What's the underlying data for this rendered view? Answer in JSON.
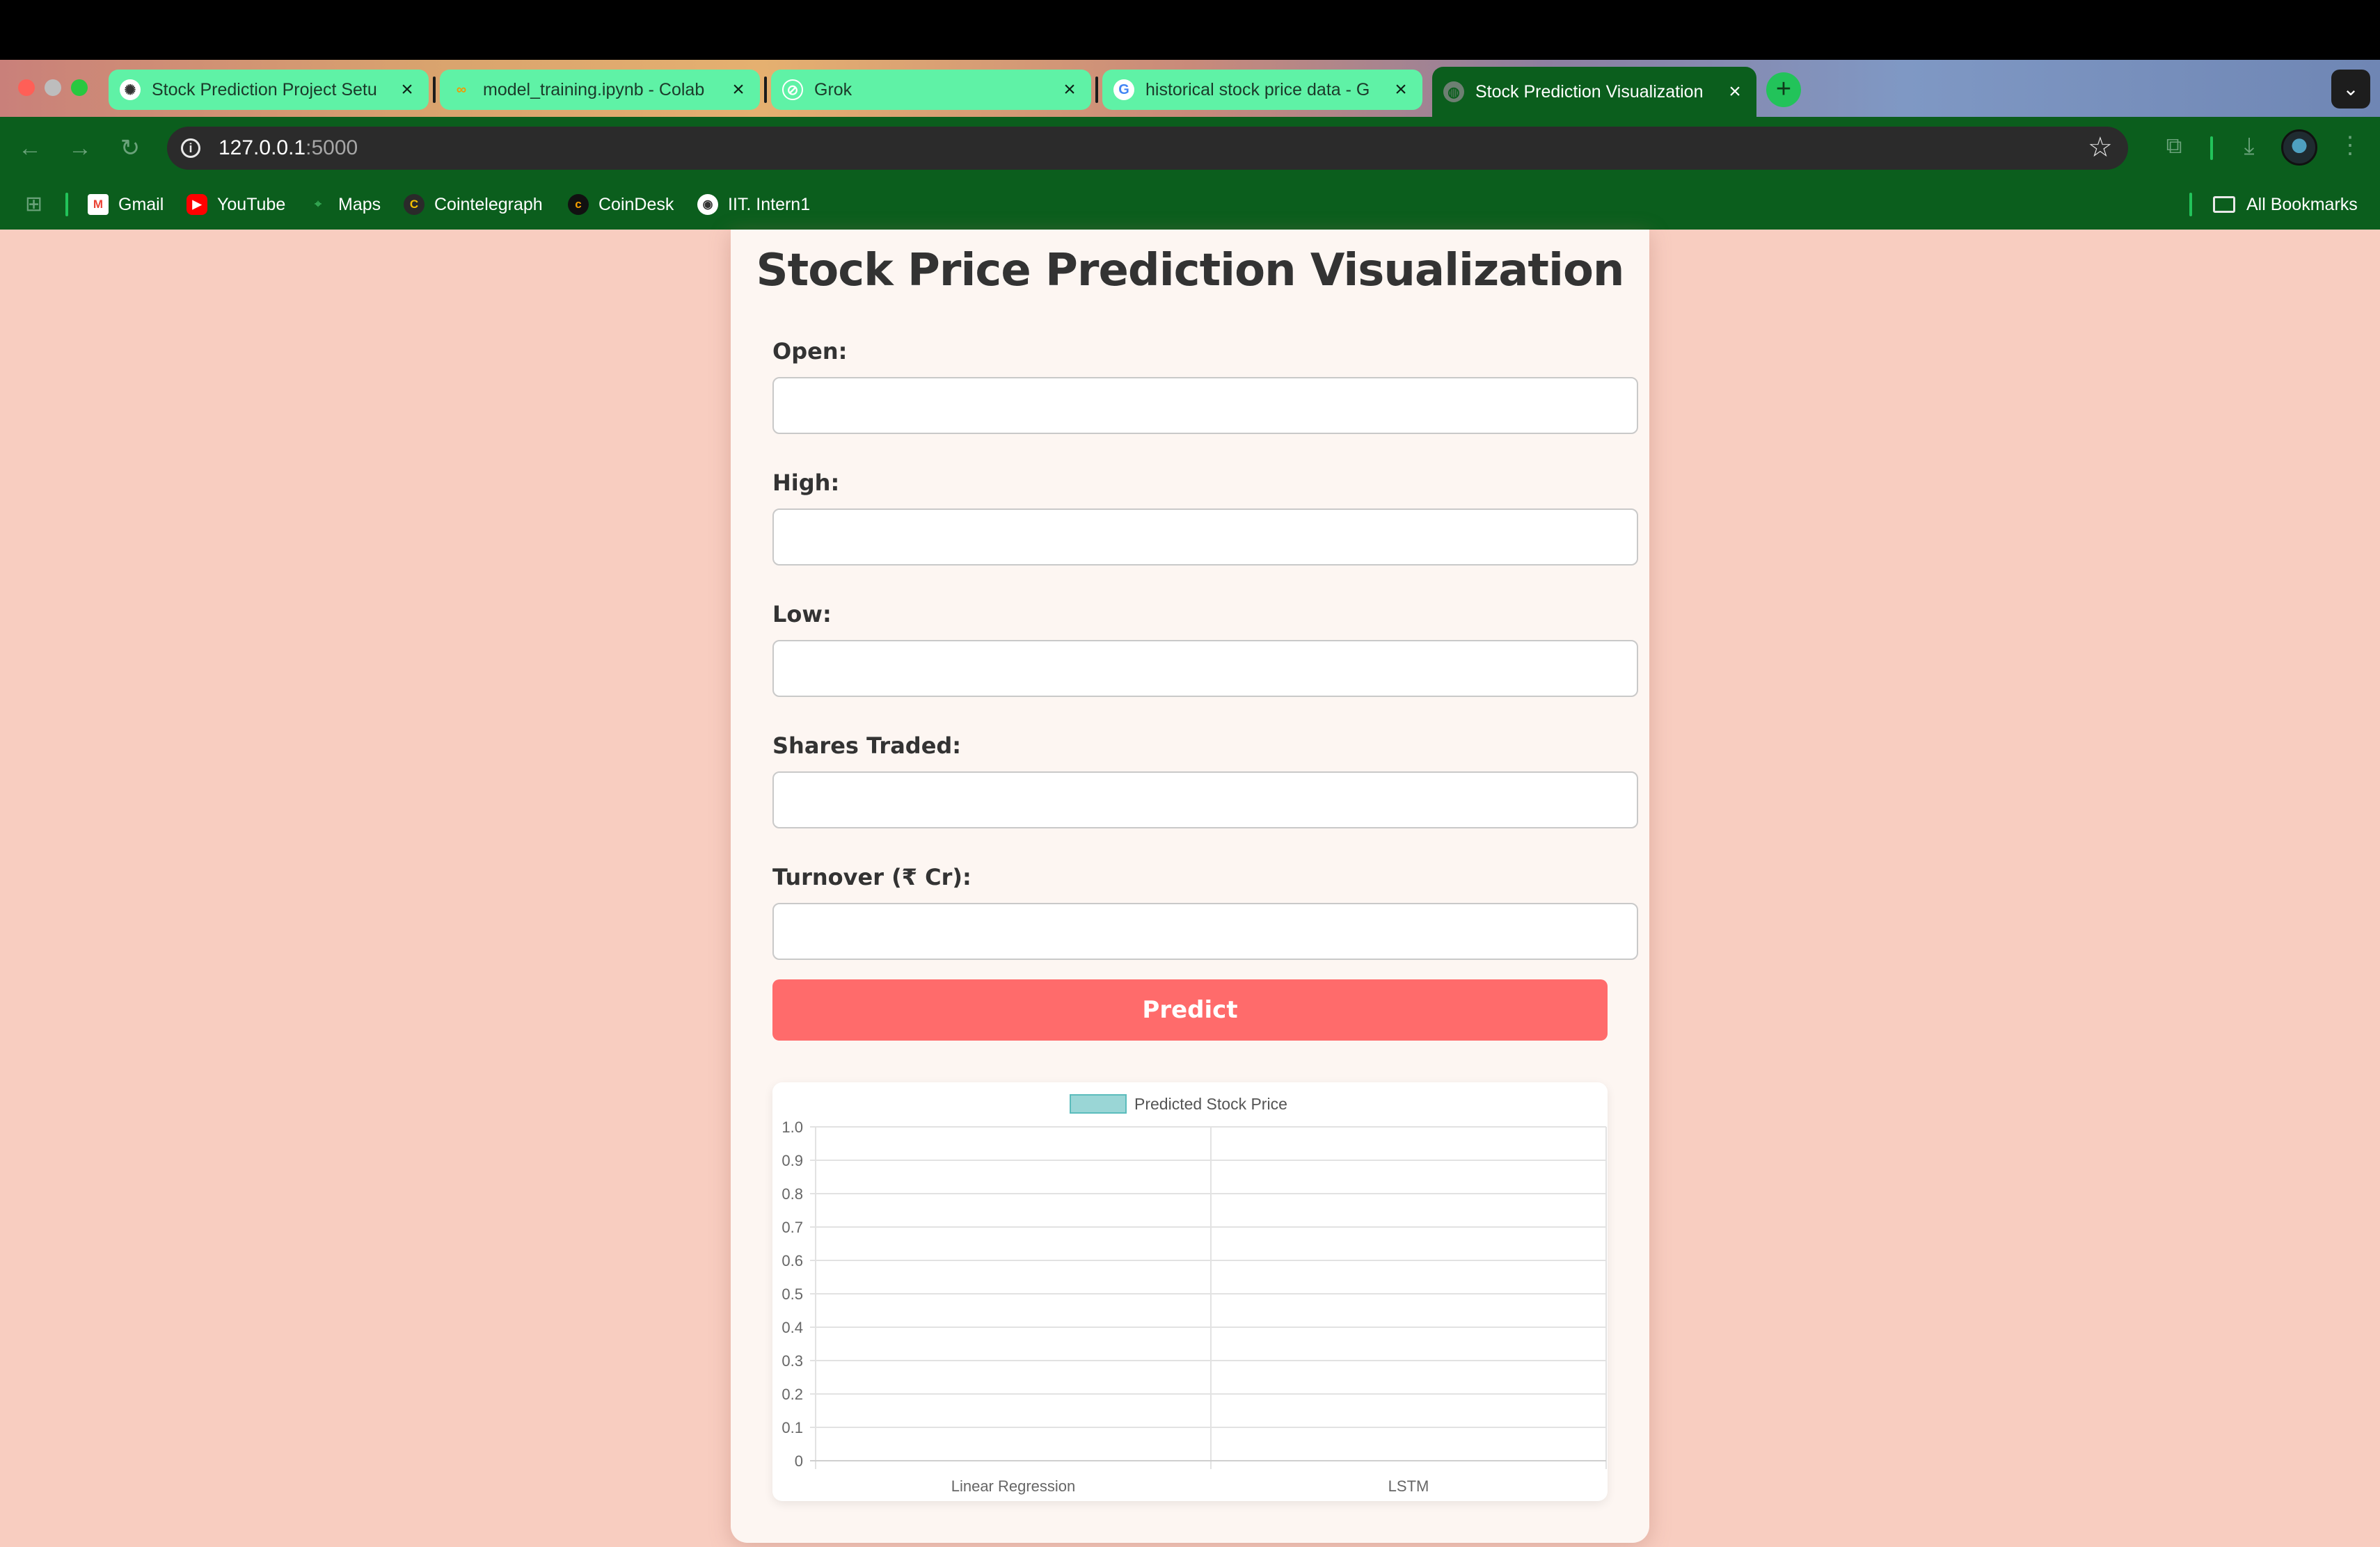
{
  "browser": {
    "tabs": [
      {
        "title": "Stock Prediction Project Setu",
        "favicon": "openai-icon",
        "active": false
      },
      {
        "title": "model_training.ipynb - Colab",
        "favicon": "colab-icon",
        "active": false
      },
      {
        "title": "Grok",
        "favicon": "grok-icon",
        "active": false
      },
      {
        "title": "historical stock price data - G",
        "favicon": "google-icon",
        "active": false
      },
      {
        "title": "Stock Prediction Visualization",
        "favicon": "globe-icon",
        "active": true
      }
    ],
    "close_glyph": "×",
    "new_tab_glyph": "+",
    "tab_menu_glyph": "⌄",
    "url_host": "127.0.0.1",
    "url_port": ":5000",
    "bookmarks": [
      {
        "label": "Gmail",
        "icon": "gmail-icon"
      },
      {
        "label": "YouTube",
        "icon": "youtube-icon"
      },
      {
        "label": "Maps",
        "icon": "maps-icon"
      },
      {
        "label": "Cointelegraph",
        "icon": "cointelegraph-icon"
      },
      {
        "label": "CoinDesk",
        "icon": "coindesk-icon"
      },
      {
        "label": "IIT. Intern1",
        "icon": "iit-icon"
      }
    ],
    "all_bookmarks_label": "All Bookmarks",
    "colors": {
      "tab": "#5ff2a6",
      "toolbar": "#0b5e1d",
      "accent": "#22c35a"
    }
  },
  "page": {
    "title": "Stock Price Prediction Visualization",
    "fields": [
      {
        "label": "Open:",
        "value": "",
        "placeholder": ""
      },
      {
        "label": "High:",
        "value": "",
        "placeholder": ""
      },
      {
        "label": "Low:",
        "value": "",
        "placeholder": ""
      },
      {
        "label": "Shares Traded:",
        "value": "",
        "placeholder": ""
      },
      {
        "label": "Turnover (₹ Cr):",
        "value": "",
        "placeholder": ""
      }
    ],
    "predict_label": "Predict",
    "colors": {
      "background": "#f8cdc0",
      "card": "#fdf6f2",
      "button": "#ff6b6b",
      "bar_fill": "#9ad6d6",
      "bar_border": "#5bbcbc"
    }
  },
  "chart_data": {
    "type": "bar",
    "categories": [
      "Linear Regression",
      "LSTM"
    ],
    "series": [
      {
        "name": "Predicted Stock Price",
        "values": [
          null,
          null
        ]
      }
    ],
    "ylim": [
      0,
      1
    ],
    "yticks": [
      "0",
      "0.1",
      "0.2",
      "0.3",
      "0.4",
      "0.5",
      "0.6",
      "0.7",
      "0.8",
      "0.9",
      "1.0"
    ],
    "legend": "top",
    "grid": true,
    "title": "",
    "xlabel": "",
    "ylabel": ""
  }
}
